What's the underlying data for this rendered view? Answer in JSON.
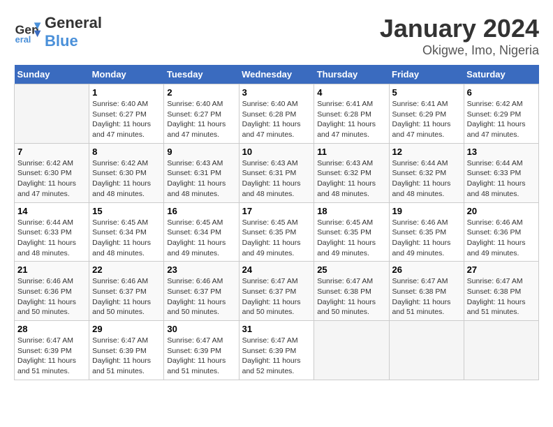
{
  "logo": {
    "line1": "General",
    "line2": "Blue"
  },
  "title": "January 2024",
  "subtitle": "Okigwe, Imo, Nigeria",
  "days_of_week": [
    "Sunday",
    "Monday",
    "Tuesday",
    "Wednesday",
    "Thursday",
    "Friday",
    "Saturday"
  ],
  "weeks": [
    [
      {
        "day": "",
        "sunrise": "",
        "sunset": "",
        "daylight": ""
      },
      {
        "day": "1",
        "sunrise": "Sunrise: 6:40 AM",
        "sunset": "Sunset: 6:27 PM",
        "daylight": "Daylight: 11 hours and 47 minutes."
      },
      {
        "day": "2",
        "sunrise": "Sunrise: 6:40 AM",
        "sunset": "Sunset: 6:27 PM",
        "daylight": "Daylight: 11 hours and 47 minutes."
      },
      {
        "day": "3",
        "sunrise": "Sunrise: 6:40 AM",
        "sunset": "Sunset: 6:28 PM",
        "daylight": "Daylight: 11 hours and 47 minutes."
      },
      {
        "day": "4",
        "sunrise": "Sunrise: 6:41 AM",
        "sunset": "Sunset: 6:28 PM",
        "daylight": "Daylight: 11 hours and 47 minutes."
      },
      {
        "day": "5",
        "sunrise": "Sunrise: 6:41 AM",
        "sunset": "Sunset: 6:29 PM",
        "daylight": "Daylight: 11 hours and 47 minutes."
      },
      {
        "day": "6",
        "sunrise": "Sunrise: 6:42 AM",
        "sunset": "Sunset: 6:29 PM",
        "daylight": "Daylight: 11 hours and 47 minutes."
      }
    ],
    [
      {
        "day": "7",
        "sunrise": "Sunrise: 6:42 AM",
        "sunset": "Sunset: 6:30 PM",
        "daylight": "Daylight: 11 hours and 47 minutes."
      },
      {
        "day": "8",
        "sunrise": "Sunrise: 6:42 AM",
        "sunset": "Sunset: 6:30 PM",
        "daylight": "Daylight: 11 hours and 48 minutes."
      },
      {
        "day": "9",
        "sunrise": "Sunrise: 6:43 AM",
        "sunset": "Sunset: 6:31 PM",
        "daylight": "Daylight: 11 hours and 48 minutes."
      },
      {
        "day": "10",
        "sunrise": "Sunrise: 6:43 AM",
        "sunset": "Sunset: 6:31 PM",
        "daylight": "Daylight: 11 hours and 48 minutes."
      },
      {
        "day": "11",
        "sunrise": "Sunrise: 6:43 AM",
        "sunset": "Sunset: 6:32 PM",
        "daylight": "Daylight: 11 hours and 48 minutes."
      },
      {
        "day": "12",
        "sunrise": "Sunrise: 6:44 AM",
        "sunset": "Sunset: 6:32 PM",
        "daylight": "Daylight: 11 hours and 48 minutes."
      },
      {
        "day": "13",
        "sunrise": "Sunrise: 6:44 AM",
        "sunset": "Sunset: 6:33 PM",
        "daylight": "Daylight: 11 hours and 48 minutes."
      }
    ],
    [
      {
        "day": "14",
        "sunrise": "Sunrise: 6:44 AM",
        "sunset": "Sunset: 6:33 PM",
        "daylight": "Daylight: 11 hours and 48 minutes."
      },
      {
        "day": "15",
        "sunrise": "Sunrise: 6:45 AM",
        "sunset": "Sunset: 6:34 PM",
        "daylight": "Daylight: 11 hours and 48 minutes."
      },
      {
        "day": "16",
        "sunrise": "Sunrise: 6:45 AM",
        "sunset": "Sunset: 6:34 PM",
        "daylight": "Daylight: 11 hours and 49 minutes."
      },
      {
        "day": "17",
        "sunrise": "Sunrise: 6:45 AM",
        "sunset": "Sunset: 6:35 PM",
        "daylight": "Daylight: 11 hours and 49 minutes."
      },
      {
        "day": "18",
        "sunrise": "Sunrise: 6:45 AM",
        "sunset": "Sunset: 6:35 PM",
        "daylight": "Daylight: 11 hours and 49 minutes."
      },
      {
        "day": "19",
        "sunrise": "Sunrise: 6:46 AM",
        "sunset": "Sunset: 6:35 PM",
        "daylight": "Daylight: 11 hours and 49 minutes."
      },
      {
        "day": "20",
        "sunrise": "Sunrise: 6:46 AM",
        "sunset": "Sunset: 6:36 PM",
        "daylight": "Daylight: 11 hours and 49 minutes."
      }
    ],
    [
      {
        "day": "21",
        "sunrise": "Sunrise: 6:46 AM",
        "sunset": "Sunset: 6:36 PM",
        "daylight": "Daylight: 11 hours and 50 minutes."
      },
      {
        "day": "22",
        "sunrise": "Sunrise: 6:46 AM",
        "sunset": "Sunset: 6:37 PM",
        "daylight": "Daylight: 11 hours and 50 minutes."
      },
      {
        "day": "23",
        "sunrise": "Sunrise: 6:46 AM",
        "sunset": "Sunset: 6:37 PM",
        "daylight": "Daylight: 11 hours and 50 minutes."
      },
      {
        "day": "24",
        "sunrise": "Sunrise: 6:47 AM",
        "sunset": "Sunset: 6:37 PM",
        "daylight": "Daylight: 11 hours and 50 minutes."
      },
      {
        "day": "25",
        "sunrise": "Sunrise: 6:47 AM",
        "sunset": "Sunset: 6:38 PM",
        "daylight": "Daylight: 11 hours and 50 minutes."
      },
      {
        "day": "26",
        "sunrise": "Sunrise: 6:47 AM",
        "sunset": "Sunset: 6:38 PM",
        "daylight": "Daylight: 11 hours and 51 minutes."
      },
      {
        "day": "27",
        "sunrise": "Sunrise: 6:47 AM",
        "sunset": "Sunset: 6:38 PM",
        "daylight": "Daylight: 11 hours and 51 minutes."
      }
    ],
    [
      {
        "day": "28",
        "sunrise": "Sunrise: 6:47 AM",
        "sunset": "Sunset: 6:39 PM",
        "daylight": "Daylight: 11 hours and 51 minutes."
      },
      {
        "day": "29",
        "sunrise": "Sunrise: 6:47 AM",
        "sunset": "Sunset: 6:39 PM",
        "daylight": "Daylight: 11 hours and 51 minutes."
      },
      {
        "day": "30",
        "sunrise": "Sunrise: 6:47 AM",
        "sunset": "Sunset: 6:39 PM",
        "daylight": "Daylight: 11 hours and 51 minutes."
      },
      {
        "day": "31",
        "sunrise": "Sunrise: 6:47 AM",
        "sunset": "Sunset: 6:39 PM",
        "daylight": "Daylight: 11 hours and 52 minutes."
      },
      {
        "day": "",
        "sunrise": "",
        "sunset": "",
        "daylight": ""
      },
      {
        "day": "",
        "sunrise": "",
        "sunset": "",
        "daylight": ""
      },
      {
        "day": "",
        "sunrise": "",
        "sunset": "",
        "daylight": ""
      }
    ]
  ]
}
